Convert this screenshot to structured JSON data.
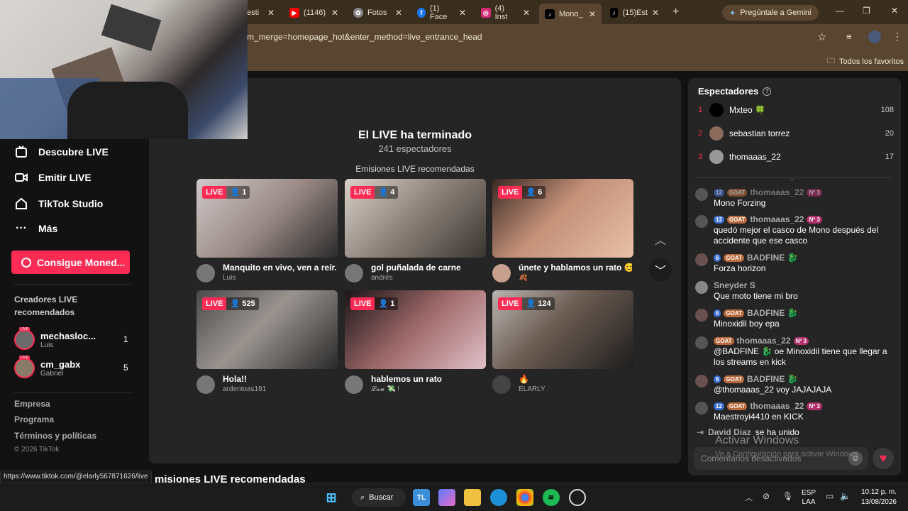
{
  "browser": {
    "tabs": [
      {
        "label": "esti",
        "icon": "generic-tab-icon"
      },
      {
        "label": "(1146)",
        "icon": "youtube-icon"
      },
      {
        "label": "Fotos",
        "icon": "google-photos-icon"
      },
      {
        "label": "(1) Face",
        "icon": "facebook-icon"
      },
      {
        "label": "(4) Inst",
        "icon": "instagram-icon"
      },
      {
        "label": "Mono_",
        "icon": "tiktok-icon"
      },
      {
        "label": "(15)Est",
        "icon": "tiktok-icon"
      }
    ],
    "gemini_label": "Pregúntale a Gemini",
    "url": "m_merge=homepage_hot&enter_method=live_entrance_head",
    "bookmarks_label": "Todos los favoritos"
  },
  "sidebar": {
    "nav": [
      {
        "label": "Descubre LIVE",
        "icon": "live-tv-icon"
      },
      {
        "label": "Emitir LIVE",
        "icon": "camera-icon"
      },
      {
        "label": "TikTok Studio",
        "icon": "home-icon"
      },
      {
        "label": "Más",
        "icon": "more-icon"
      }
    ],
    "coins_button": "Consigue Moned...",
    "creators_heading": "Creadores LIVE recomendados",
    "live_tag": "LIVE",
    "creators": [
      {
        "name": "mechasloc...",
        "sub": "Luis",
        "count": "1"
      },
      {
        "name": "cm_gabx",
        "sub": "Gabriel",
        "count": "5"
      }
    ],
    "footer": [
      "Empresa",
      "Programa",
      "Términos y políticas"
    ],
    "copyright": "© 2026 TikTok"
  },
  "main": {
    "ended_title": "El LIVE ha terminado",
    "viewers_line": "241 espectadores",
    "recommended_heading": "Emisiones LIVE recomendadas",
    "live_label": "LIVE",
    "cards": [
      {
        "viewers": "1",
        "title": "Manquito en vivo, ven a reír...",
        "user": "Luis"
      },
      {
        "viewers": "4",
        "title": "gol puñalada de carne",
        "user": "andrés"
      },
      {
        "viewers": "6",
        "title": "únete y hablamos un rato 😊",
        "user": "🍂"
      },
      {
        "viewers": "525",
        "title": "Hola!!",
        "user": "ardentoas191"
      },
      {
        "viewers": "1",
        "title": "hablemos un rato",
        "user": "𝓛𝓪𝓾 💸 !"
      },
      {
        "viewers": "124",
        "title": "🔥",
        "user": "ELARLY"
      }
    ],
    "below_heading": "misiones LIVE recomendadas"
  },
  "viewers_panel": {
    "title": "Espectadores",
    "list": [
      {
        "rank": "1",
        "name": "Mxteo 🍀",
        "count": "108"
      },
      {
        "rank": "2",
        "name": "sebastian torrez",
        "count": "20"
      },
      {
        "rank": "3",
        "name": "thomaaas_22",
        "count": "17"
      }
    ]
  },
  "chat": [
    {
      "user": "thomaaas_22",
      "badges": [
        "12",
        "GOAT",
        "Nº 3"
      ],
      "text": "Mono Forzing"
    },
    {
      "user": "thomaaas_22",
      "badges": [
        "12",
        "GOAT",
        "Nº 3"
      ],
      "text": "quedó mejor el casco de Mono después del accidente que ese casco"
    },
    {
      "user": "BADFINE 🐉",
      "badges": [
        "6",
        "GOAT"
      ],
      "text": "Forza horizon"
    },
    {
      "user": "Sneyder S",
      "badges": [],
      "text": "Que moto tiene mi bro"
    },
    {
      "user": "BADFINE 🐉",
      "badges": [
        "6",
        "GOAT"
      ],
      "text": "Minoxidil boy epa"
    },
    {
      "user": "thomaaas_22",
      "badges": [
        "GOAT",
        "Nº 3"
      ],
      "text": "@BADFINE 🐉 oe Minoxidil tiene que llegar a los streams en kick"
    },
    {
      "user": "BADFINE 🐉",
      "badges": [
        "6",
        "GOAT"
      ],
      "text": "@thomaaas_22 voy JAJAJAJA"
    },
    {
      "user": "thomaaas_22",
      "badges": [
        "12",
        "GOAT",
        "Nº 3"
      ],
      "text": "Maestroyi4410 en KICK"
    }
  ],
  "joined": {
    "user": "David Diaz",
    "text": "se ha unido"
  },
  "comment_placeholder": "Comentarios desactivados",
  "windows_watermark": {
    "title": "Activar Windows",
    "sub": "Ve a Configuración para activar Windows."
  },
  "status_url": "https://www.tiktok.com/@elarly567871626/live",
  "taskbar": {
    "search": "Buscar",
    "lang": "ESP",
    "layout": "LAA",
    "time": "10:12 p. m.",
    "date": "13/08/2026"
  },
  "colors": {
    "accent": "#fe2c55",
    "chrome": "#5a4630",
    "panel": "#252525"
  }
}
